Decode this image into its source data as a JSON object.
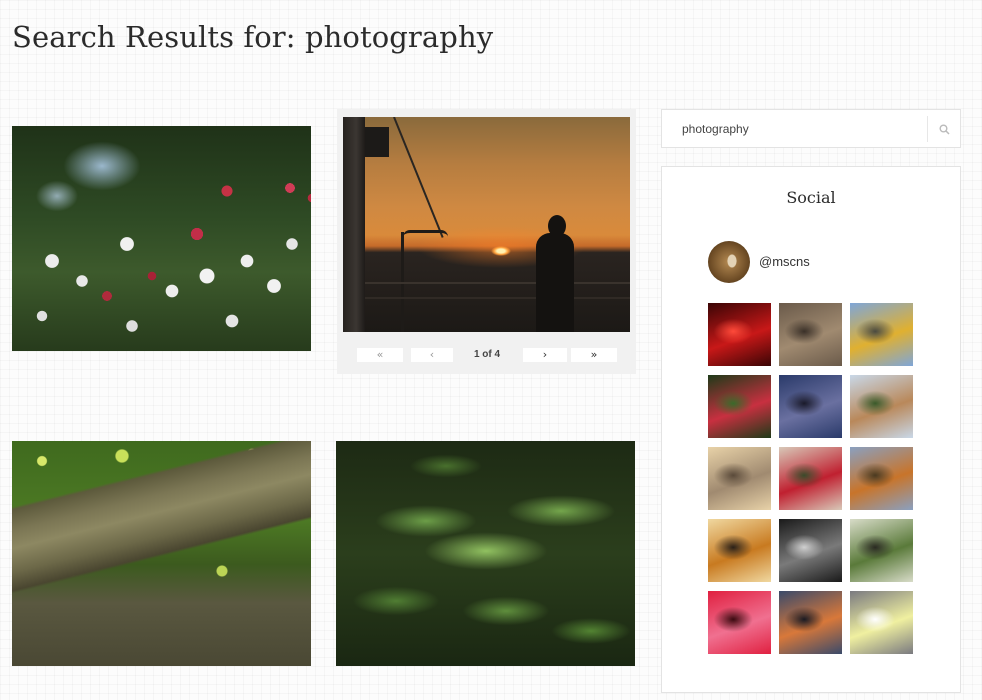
{
  "page": {
    "title": "Search Results for: photography"
  },
  "results": [
    {
      "name": "flowers-photo",
      "icon": "photo-flowers"
    },
    {
      "name": "sunset-photo",
      "icon": "photo-sunset-silhouette"
    },
    {
      "name": "branch-photo",
      "icon": "photo-mossy-branch"
    },
    {
      "name": "fern-photo",
      "icon": "photo-fern-leaves"
    }
  ],
  "gallery_pager": {
    "first": "«",
    "prev": "‹",
    "status": "1 of 4",
    "next": "›",
    "last": "»"
  },
  "search": {
    "value": "photography",
    "icon": "search-icon"
  },
  "social": {
    "title": "Social",
    "username": "@mscns",
    "thumbnails": [
      {
        "name": "neon-sign",
        "colors": [
          "#3a0505",
          "#c81818",
          "#ff4a3a"
        ]
      },
      {
        "name": "train-interior",
        "colors": [
          "#6a5a4a",
          "#a08a70",
          "#3a3028"
        ]
      },
      {
        "name": "yellow-tram",
        "colors": [
          "#7fa6d8",
          "#e0b030",
          "#4a4a40"
        ]
      },
      {
        "name": "red-flowers",
        "colors": [
          "#1e3a18",
          "#c83040",
          "#3a6a2a"
        ]
      },
      {
        "name": "dusk-sky",
        "colors": [
          "#2a3a6a",
          "#6a70a0",
          "#1a1a2a"
        ]
      },
      {
        "name": "balconies",
        "colors": [
          "#c9d8e8",
          "#b9885a",
          "#3a5a2a"
        ]
      },
      {
        "name": "horses",
        "colors": [
          "#e8d2a8",
          "#a08a70",
          "#5a4a3a"
        ]
      },
      {
        "name": "red-blossoms",
        "colors": [
          "#d8c8b8",
          "#c02030",
          "#3a4a2a"
        ]
      },
      {
        "name": "autumn-tree",
        "colors": [
          "#8aa0c0",
          "#c8742a",
          "#4a3a20"
        ]
      },
      {
        "name": "cat",
        "colors": [
          "#f0d8a0",
          "#c87a20",
          "#2a2018"
        ]
      },
      {
        "name": "bw-people",
        "colors": [
          "#1a1a1a",
          "#7a7a7a",
          "#d0d0d0"
        ]
      },
      {
        "name": "window-plant",
        "colors": [
          "#d8dcc8",
          "#5a7a3a",
          "#2a2a22"
        ]
      },
      {
        "name": "red-neon",
        "colors": [
          "#e02040",
          "#f07090",
          "#3a0a10"
        ]
      },
      {
        "name": "city-sunset",
        "colors": [
          "#3a4a6a",
          "#d8783a",
          "#1a1a22"
        ]
      },
      {
        "name": "neon-tubes",
        "colors": [
          "#7a7a80",
          "#f0f0a0",
          "#ffffff"
        ]
      }
    ]
  }
}
